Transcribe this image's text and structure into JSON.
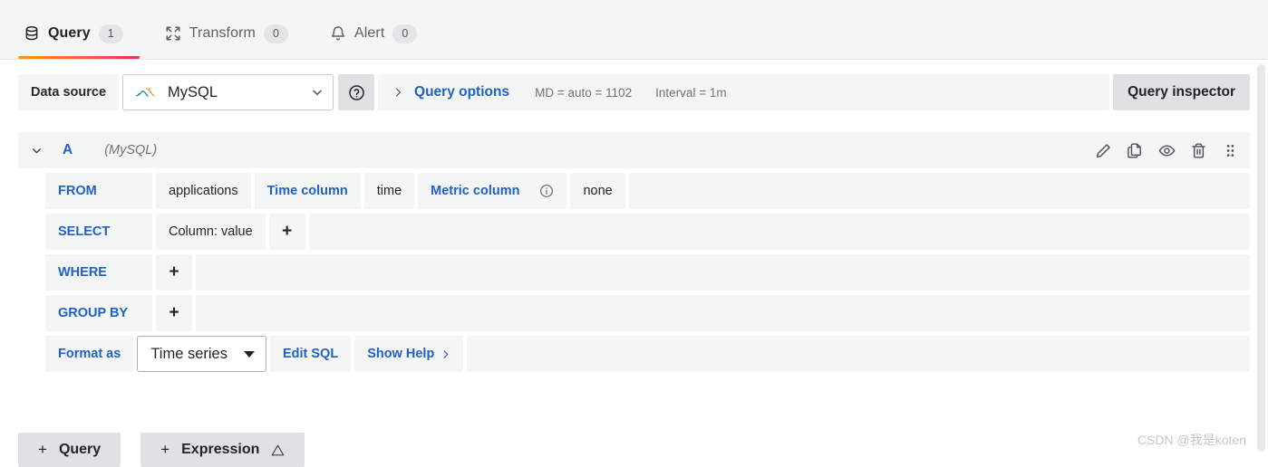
{
  "tabs": [
    {
      "label": "Query",
      "count": "1",
      "icon": "database-icon",
      "active": true
    },
    {
      "label": "Transform",
      "count": "0",
      "icon": "transform-icon",
      "active": false
    },
    {
      "label": "Alert",
      "count": "0",
      "icon": "bell-icon",
      "active": false
    }
  ],
  "datasource_row": {
    "label": "Data source",
    "selected": "MySQL",
    "help_icon": "question-circle-icon",
    "query_options": {
      "title": "Query options",
      "expand_icon": "chevron-right-icon",
      "max_data_points": "MD = auto = 1102",
      "interval": "Interval = 1m"
    },
    "query_inspector": "Query inspector"
  },
  "query": {
    "ref_id": "A",
    "datasource_note": "(MySQL)",
    "collapse_icon": "chevron-down-icon",
    "actions": [
      {
        "name": "edit-query-icon",
        "title": "Edit"
      },
      {
        "name": "duplicate-query-icon",
        "title": "Duplicate"
      },
      {
        "name": "toggle-visibility-icon",
        "title": "Hide response"
      },
      {
        "name": "delete-query-icon",
        "title": "Remove"
      },
      {
        "name": "drag-handle-icon",
        "title": "Drag"
      }
    ],
    "from_row": {
      "key": "FROM",
      "table": "applications",
      "time_column_label": "Time column",
      "time_column_value": "time",
      "metric_column_label": "Metric column",
      "metric_column_info_icon": "info-circle-icon",
      "metric_column_value": "none"
    },
    "select_row": {
      "key": "SELECT",
      "column": "Column: value",
      "add": "+"
    },
    "where_row": {
      "key": "WHERE",
      "add": "+"
    },
    "group_by_row": {
      "key": "GROUP BY",
      "add": "+"
    },
    "format_row": {
      "key": "Format as",
      "format_value": "Time series",
      "edit_sql": "Edit SQL",
      "show_help": "Show Help",
      "show_help_icon": "chevron-right-icon"
    }
  },
  "bottom": {
    "add_query": "Query",
    "add_expression": "Expression",
    "plus": "+",
    "expression_warning_icon": "warning-triangle-icon"
  },
  "watermark": "CSDN @我是koten",
  "colors": {
    "link_blue": "#1f61c4",
    "panel_grey": "#f4f5f5",
    "button_grey": "#dfe1e3",
    "tab_underline_from": "#f89713",
    "tab_underline_to": "#ed2e4a"
  }
}
